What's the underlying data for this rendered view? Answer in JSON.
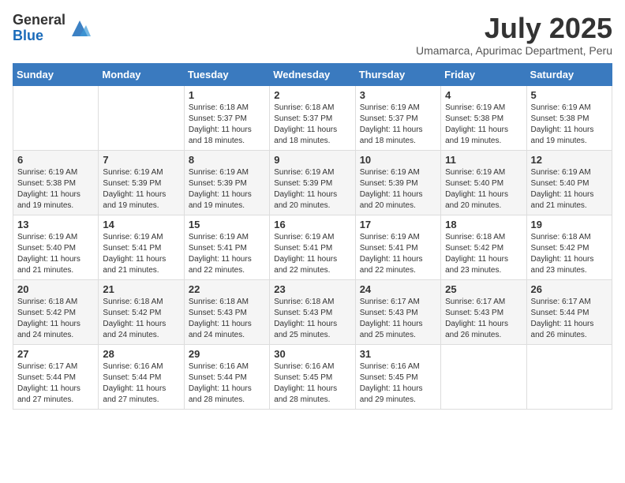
{
  "logo": {
    "general": "General",
    "blue": "Blue"
  },
  "title": "July 2025",
  "subtitle": "Umamarca, Apurimac Department, Peru",
  "weekdays": [
    "Sunday",
    "Monday",
    "Tuesday",
    "Wednesday",
    "Thursday",
    "Friday",
    "Saturday"
  ],
  "weeks": [
    [
      {
        "day": "",
        "info": ""
      },
      {
        "day": "",
        "info": ""
      },
      {
        "day": "1",
        "info": "Sunrise: 6:18 AM\nSunset: 5:37 PM\nDaylight: 11 hours and 18 minutes."
      },
      {
        "day": "2",
        "info": "Sunrise: 6:18 AM\nSunset: 5:37 PM\nDaylight: 11 hours and 18 minutes."
      },
      {
        "day": "3",
        "info": "Sunrise: 6:19 AM\nSunset: 5:37 PM\nDaylight: 11 hours and 18 minutes."
      },
      {
        "day": "4",
        "info": "Sunrise: 6:19 AM\nSunset: 5:38 PM\nDaylight: 11 hours and 19 minutes."
      },
      {
        "day": "5",
        "info": "Sunrise: 6:19 AM\nSunset: 5:38 PM\nDaylight: 11 hours and 19 minutes."
      }
    ],
    [
      {
        "day": "6",
        "info": "Sunrise: 6:19 AM\nSunset: 5:38 PM\nDaylight: 11 hours and 19 minutes."
      },
      {
        "day": "7",
        "info": "Sunrise: 6:19 AM\nSunset: 5:39 PM\nDaylight: 11 hours and 19 minutes."
      },
      {
        "day": "8",
        "info": "Sunrise: 6:19 AM\nSunset: 5:39 PM\nDaylight: 11 hours and 19 minutes."
      },
      {
        "day": "9",
        "info": "Sunrise: 6:19 AM\nSunset: 5:39 PM\nDaylight: 11 hours and 20 minutes."
      },
      {
        "day": "10",
        "info": "Sunrise: 6:19 AM\nSunset: 5:39 PM\nDaylight: 11 hours and 20 minutes."
      },
      {
        "day": "11",
        "info": "Sunrise: 6:19 AM\nSunset: 5:40 PM\nDaylight: 11 hours and 20 minutes."
      },
      {
        "day": "12",
        "info": "Sunrise: 6:19 AM\nSunset: 5:40 PM\nDaylight: 11 hours and 21 minutes."
      }
    ],
    [
      {
        "day": "13",
        "info": "Sunrise: 6:19 AM\nSunset: 5:40 PM\nDaylight: 11 hours and 21 minutes."
      },
      {
        "day": "14",
        "info": "Sunrise: 6:19 AM\nSunset: 5:41 PM\nDaylight: 11 hours and 21 minutes."
      },
      {
        "day": "15",
        "info": "Sunrise: 6:19 AM\nSunset: 5:41 PM\nDaylight: 11 hours and 22 minutes."
      },
      {
        "day": "16",
        "info": "Sunrise: 6:19 AM\nSunset: 5:41 PM\nDaylight: 11 hours and 22 minutes."
      },
      {
        "day": "17",
        "info": "Sunrise: 6:19 AM\nSunset: 5:41 PM\nDaylight: 11 hours and 22 minutes."
      },
      {
        "day": "18",
        "info": "Sunrise: 6:18 AM\nSunset: 5:42 PM\nDaylight: 11 hours and 23 minutes."
      },
      {
        "day": "19",
        "info": "Sunrise: 6:18 AM\nSunset: 5:42 PM\nDaylight: 11 hours and 23 minutes."
      }
    ],
    [
      {
        "day": "20",
        "info": "Sunrise: 6:18 AM\nSunset: 5:42 PM\nDaylight: 11 hours and 24 minutes."
      },
      {
        "day": "21",
        "info": "Sunrise: 6:18 AM\nSunset: 5:42 PM\nDaylight: 11 hours and 24 minutes."
      },
      {
        "day": "22",
        "info": "Sunrise: 6:18 AM\nSunset: 5:43 PM\nDaylight: 11 hours and 24 minutes."
      },
      {
        "day": "23",
        "info": "Sunrise: 6:18 AM\nSunset: 5:43 PM\nDaylight: 11 hours and 25 minutes."
      },
      {
        "day": "24",
        "info": "Sunrise: 6:17 AM\nSunset: 5:43 PM\nDaylight: 11 hours and 25 minutes."
      },
      {
        "day": "25",
        "info": "Sunrise: 6:17 AM\nSunset: 5:43 PM\nDaylight: 11 hours and 26 minutes."
      },
      {
        "day": "26",
        "info": "Sunrise: 6:17 AM\nSunset: 5:44 PM\nDaylight: 11 hours and 26 minutes."
      }
    ],
    [
      {
        "day": "27",
        "info": "Sunrise: 6:17 AM\nSunset: 5:44 PM\nDaylight: 11 hours and 27 minutes."
      },
      {
        "day": "28",
        "info": "Sunrise: 6:16 AM\nSunset: 5:44 PM\nDaylight: 11 hours and 27 minutes."
      },
      {
        "day": "29",
        "info": "Sunrise: 6:16 AM\nSunset: 5:44 PM\nDaylight: 11 hours and 28 minutes."
      },
      {
        "day": "30",
        "info": "Sunrise: 6:16 AM\nSunset: 5:45 PM\nDaylight: 11 hours and 28 minutes."
      },
      {
        "day": "31",
        "info": "Sunrise: 6:16 AM\nSunset: 5:45 PM\nDaylight: 11 hours and 29 minutes."
      },
      {
        "day": "",
        "info": ""
      },
      {
        "day": "",
        "info": ""
      }
    ]
  ]
}
